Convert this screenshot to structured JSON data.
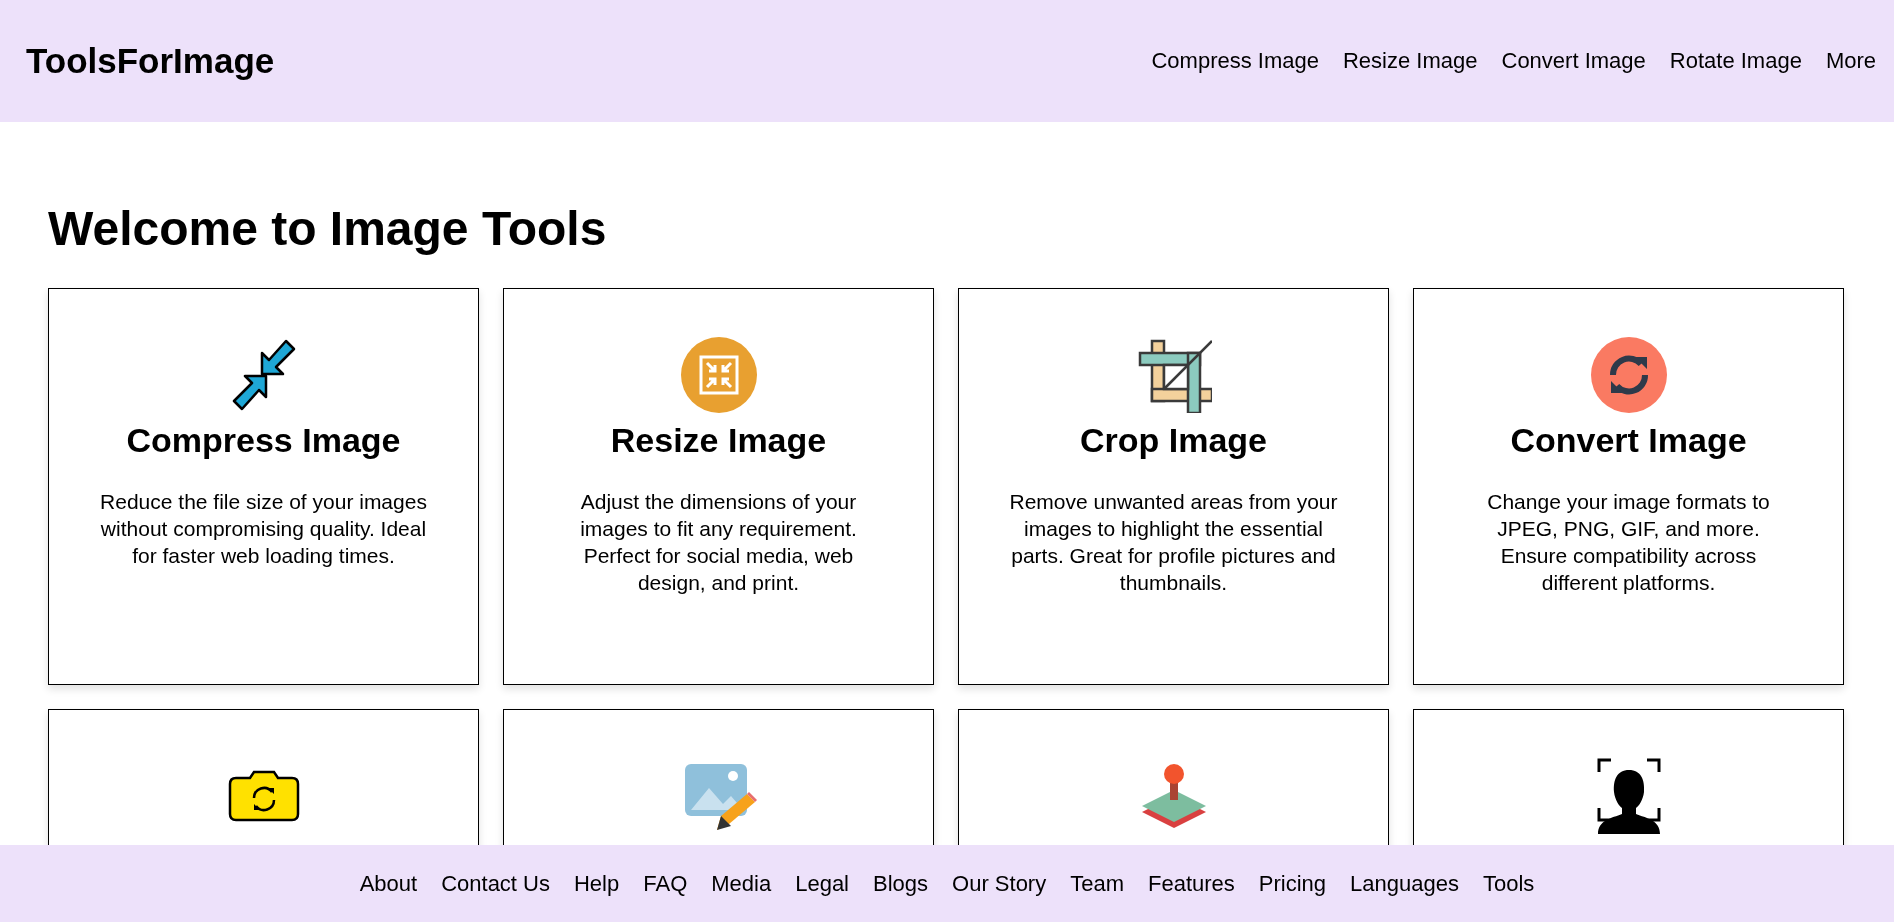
{
  "header": {
    "logo": "ToolsForImage",
    "nav": [
      "Compress Image",
      "Resize Image",
      "Convert Image",
      "Rotate Image",
      "More"
    ]
  },
  "main": {
    "title": "Welcome to Image Tools",
    "cards": [
      {
        "kind": "compress",
        "title": "Compress Image",
        "text": "Reduce the file size of your images without compromising quality. Ideal for faster web loading times."
      },
      {
        "kind": "resize",
        "title": "Resize Image",
        "text": "Adjust the dimensions of your images to fit any requirement. Perfect for social media, web design, and print."
      },
      {
        "kind": "crop",
        "title": "Crop Image",
        "text": "Remove unwanted areas from your images to highlight the essential parts. Great for profile pictures and thumbnails."
      },
      {
        "kind": "convert",
        "title": "Convert Image",
        "text": "Change your image formats to JPEG, PNG, GIF, and more. Ensure compatibility across different platforms."
      },
      {
        "kind": "rotate"
      },
      {
        "kind": "edit"
      },
      {
        "kind": "stamp"
      },
      {
        "kind": "face"
      }
    ]
  },
  "footer": {
    "links": [
      "About",
      "Contact Us",
      "Help",
      "FAQ",
      "Media",
      "Legal",
      "Blogs",
      "Our Story",
      "Team",
      "Features",
      "Pricing",
      "Languages",
      "Tools"
    ]
  }
}
